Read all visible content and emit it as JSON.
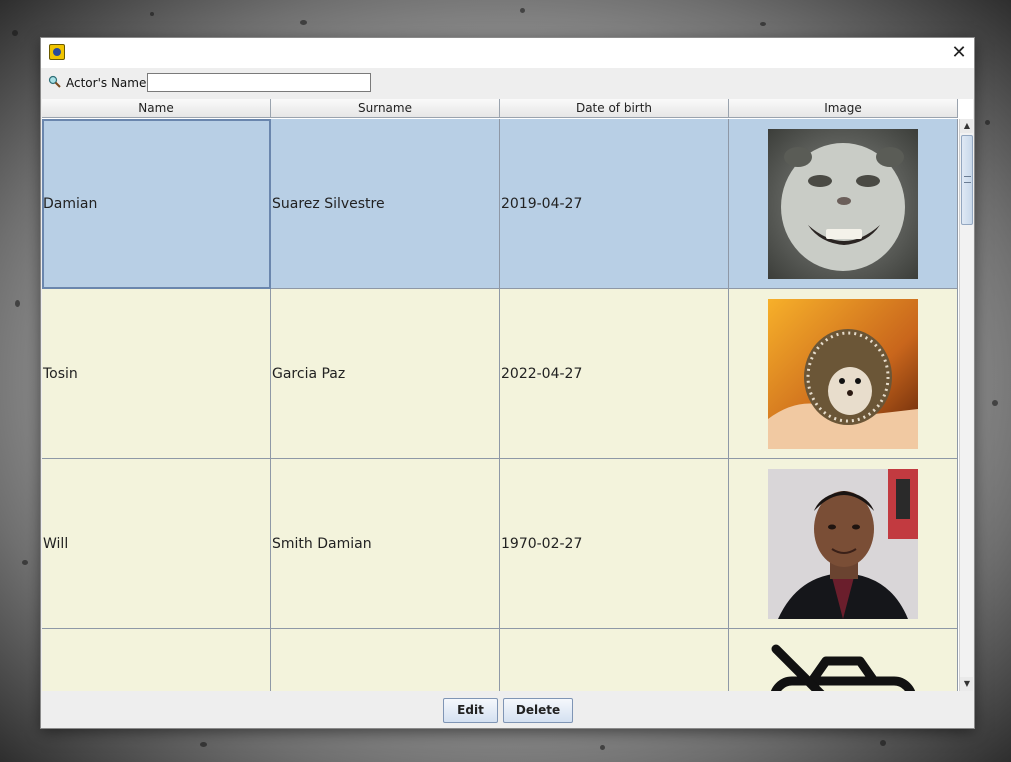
{
  "window": {
    "close_glyph": "✕",
    "app_icon": "app-logo-icon"
  },
  "search": {
    "label": "Actor's Name",
    "value": "",
    "placeholder": ""
  },
  "table": {
    "columns": [
      "Name",
      "Surname",
      "Date of birth",
      "Image"
    ],
    "rows": [
      {
        "name": "Damian",
        "surname": "Suarez Silvestre",
        "dob": "2019-04-27",
        "image": "grinning-cat-photo",
        "selected": true
      },
      {
        "name": "Tosin",
        "surname": "Garcia Paz",
        "dob": "2022-04-27",
        "image": "hedgehog-in-hand-photo",
        "selected": false
      },
      {
        "name": "Will",
        "surname": "Smith Damian",
        "dob": "1970-02-27",
        "image": "man-in-suit-portrait-photo",
        "selected": false
      },
      {
        "name": "",
        "surname": "",
        "dob": "",
        "image": "no-camera-icon",
        "selected": false
      }
    ]
  },
  "buttons": {
    "edit": "Edit",
    "delete": "Delete"
  },
  "colors": {
    "selected_row": "#b8cfe5",
    "row_background": "#f3f3dc",
    "grid": "#8e98a6"
  }
}
